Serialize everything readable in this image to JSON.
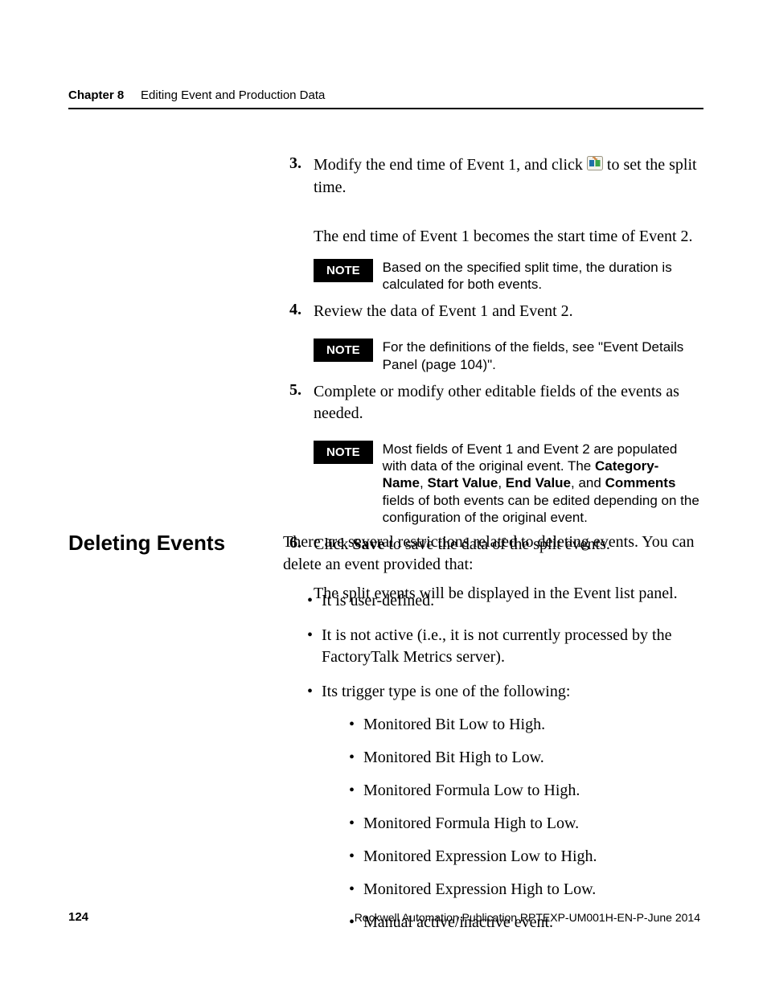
{
  "header": {
    "chapter": "Chapter 8",
    "title": "Editing Event and Production Data"
  },
  "steps": {
    "step3": {
      "num": "3.",
      "text_before_icon": "Modify the end time of Event 1, and click  ",
      "text_after_icon": "  to set the split time.",
      "after_para": "The end time of Event 1 becomes the start time of Event 2.",
      "note": "Based on the specified split time, the duration is calculated for both events."
    },
    "step4": {
      "num": "4.",
      "text": "Review the data of Event 1 and Event 2.",
      "note": "For the definitions of the fields, see \"Event Details Panel (page 104)\"."
    },
    "step5": {
      "num": "5.",
      "text": "Complete or modify other editable fields of the events as needed.",
      "note_pre": "Most fields of Event 1 and Event 2 are populated with data of the original event. The ",
      "note_b1": "Category-Name",
      "note_sep1": ", ",
      "note_b2": "Start Value",
      "note_sep2": ", ",
      "note_b3": "End Value",
      "note_sep3": ", and ",
      "note_b4": "Comments",
      "note_post": " fields of both events can be edited depending on the configuration of the original event."
    },
    "step6": {
      "num": "6.",
      "text_pre": "Click ",
      "text_b": "Save",
      "text_post": " to save the data of the split events.",
      "after_para": "The split events will be displayed in the Event list panel."
    },
    "note_label": "NOTE"
  },
  "section": {
    "title": "Deleting Events",
    "intro": "There are several restrictions related to deleting events. You can delete an event provided that:",
    "bullets": {
      "b1": "It is user-defined.",
      "b2": "It is not active (i.e., it is not currently processed by the FactoryTalk Metrics server).",
      "b3": "Its trigger type is one of the following:",
      "sub": {
        "s1": "Monitored Bit Low to High.",
        "s2": "Monitored Bit High to Low.",
        "s3": "Monitored Formula Low to High.",
        "s4": "Monitored Formula High to Low.",
        "s5": "Monitored Expression Low to High.",
        "s6": "Monitored Expression High to Low.",
        "s7": "Manual active/inactive event."
      }
    }
  },
  "footer": {
    "page": "124",
    "pub": "Rockwell Automation Publication RPTEXP-UM001H-EN-P-June 2014"
  }
}
